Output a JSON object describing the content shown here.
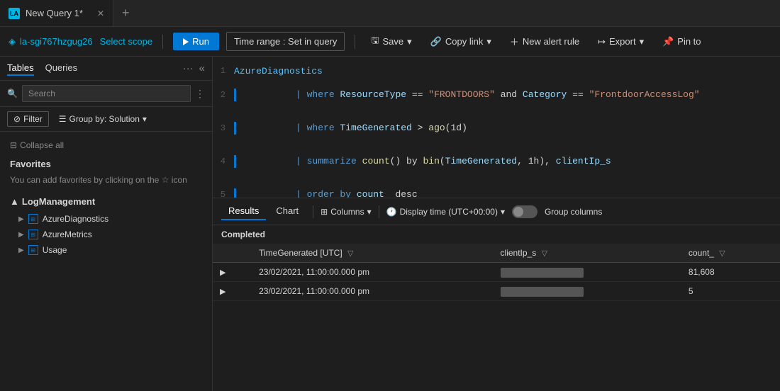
{
  "tabs": [
    {
      "id": "new-query",
      "label": "New Query 1*",
      "active": true
    }
  ],
  "tab_new_label": "+",
  "toolbar": {
    "workspace_icon": "◈",
    "workspace_name": "la-sgi767hzgug26",
    "select_scope_label": "Select scope",
    "run_label": "Run",
    "time_range_label": "Time range : Set in query",
    "save_label": "Save",
    "copy_link_label": "Copy link",
    "new_alert_label": "New alert rule",
    "export_label": "Export",
    "pin_label": "Pin to"
  },
  "sidebar": {
    "tabs": [
      {
        "id": "tables",
        "label": "Tables",
        "active": true
      },
      {
        "id": "queries",
        "label": "Queries",
        "active": false
      }
    ],
    "search_placeholder": "Search",
    "filter_label": "Filter",
    "group_by_label": "Group by: Solution",
    "collapse_all_label": "Collapse all",
    "favorites_header": "Favorites",
    "favorites_desc": "You can add favorites by clicking on the ☆ icon",
    "log_management_header": "LogManagement",
    "tree_items": [
      {
        "id": "azure-diagnostics",
        "label": "AzureDiagnostics"
      },
      {
        "id": "azure-metrics",
        "label": "AzureMetrics"
      },
      {
        "id": "usage",
        "label": "Usage"
      }
    ]
  },
  "editor": {
    "lines": [
      {
        "num": 1,
        "bar": false,
        "content": "AzureDiagnostics"
      },
      {
        "num": 2,
        "bar": true,
        "content": "    where ResourceType == \"FRONTDOORS\" and Category == \"FrontdoorAccessLog\""
      },
      {
        "num": 3,
        "bar": true,
        "content": "    where TimeGenerated > ago(1d)"
      },
      {
        "num": 4,
        "bar": true,
        "content": "    summarize count() by bin(TimeGenerated, 1h), clientIp_s"
      },
      {
        "num": 5,
        "bar": true,
        "content": "    order by count_ desc"
      }
    ]
  },
  "results": {
    "tabs": [
      {
        "id": "results",
        "label": "Results",
        "active": true
      },
      {
        "id": "chart",
        "label": "Chart",
        "active": false
      }
    ],
    "columns_label": "Columns",
    "display_time_label": "Display time (UTC+00:00)",
    "group_columns_label": "Group columns",
    "status": "Completed",
    "columns": [
      {
        "id": "expand",
        "label": ""
      },
      {
        "id": "time-generated",
        "label": "TimeGenerated [UTC]"
      },
      {
        "id": "client-ip",
        "label": "clientIp_s"
      },
      {
        "id": "count",
        "label": "count_"
      }
    ],
    "rows": [
      {
        "expand": "▶",
        "time": "23/02/2021, 11:00:00.000 pm",
        "ip": "masked",
        "count": "81,608"
      },
      {
        "expand": "▶",
        "time": "23/02/2021, 11:00:00.000 pm",
        "ip": "masked",
        "count": "5"
      }
    ]
  }
}
